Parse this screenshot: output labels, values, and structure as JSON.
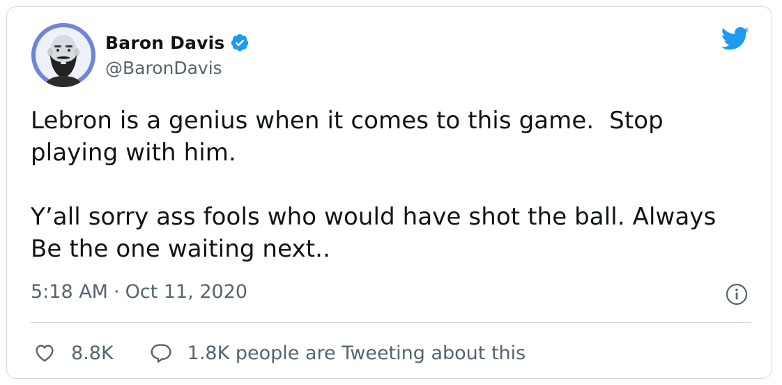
{
  "author": {
    "name": "Baron Davis",
    "handle": "@BaronDavis",
    "verified": true
  },
  "tweet": {
    "text": "Lebron is a genius when it comes to this game.  Stop\nplaying with him.\n\nY’all sorry ass fools who would have shot the ball. Always\nBe the one waiting next..",
    "time": "5:18 AM",
    "separator": "·",
    "date": "Oct 11, 2020"
  },
  "actions": {
    "likes": "8.8K",
    "conversation": "1.8K people are Tweeting about this"
  },
  "icons": {
    "verified": "verified-badge-icon",
    "brand": "twitter-bird-icon",
    "info": "info-icon",
    "like": "heart-icon",
    "reply": "speech-bubble-icon"
  },
  "colors": {
    "brand_blue": "#1d9bf0",
    "text": "#0f1419",
    "muted": "#536471",
    "border": "#cfd9de"
  }
}
